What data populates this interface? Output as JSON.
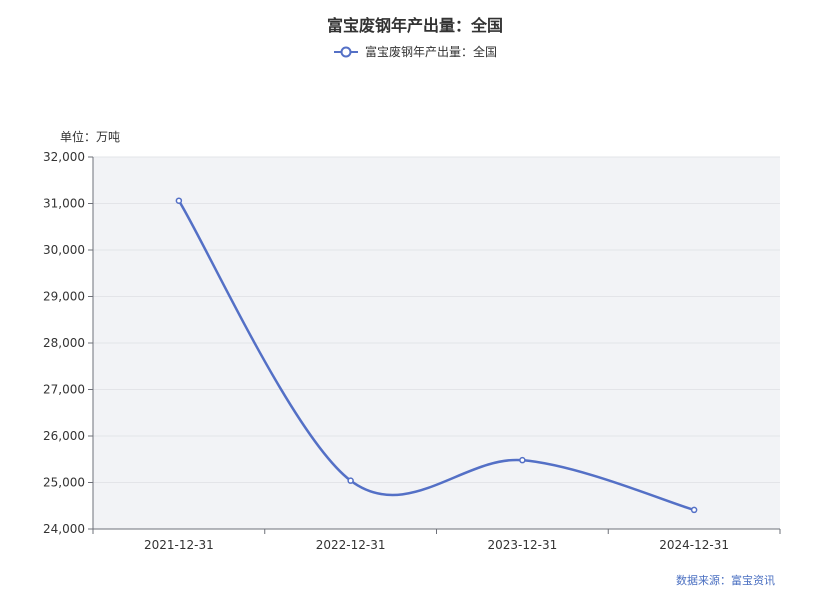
{
  "chart_data": {
    "type": "line",
    "title": "富宝废钢年产出量：全国",
    "unit_label": "单位：万吨",
    "source": "数据来源：富宝资讯",
    "categories": [
      "2021-12-31",
      "2022-12-31",
      "2023-12-31",
      "2024-12-31"
    ],
    "series": [
      {
        "name": "富宝废钢年产出量：全国",
        "values": [
          31060,
          25040,
          25480,
          24410
        ],
        "color": "#5470c6"
      }
    ],
    "ylim": [
      24000,
      32000
    ],
    "yticks": [
      24000,
      25000,
      26000,
      27000,
      28000,
      29000,
      30000,
      31000,
      32000
    ],
    "ytick_labels": [
      "24,000",
      "25,000",
      "26,000",
      "27,000",
      "28,000",
      "29,000",
      "30,000",
      "31,000",
      "32,000"
    ],
    "grid": true,
    "legend_position": "top-center",
    "plot_background": "#f2f3f6",
    "smooth": true
  }
}
